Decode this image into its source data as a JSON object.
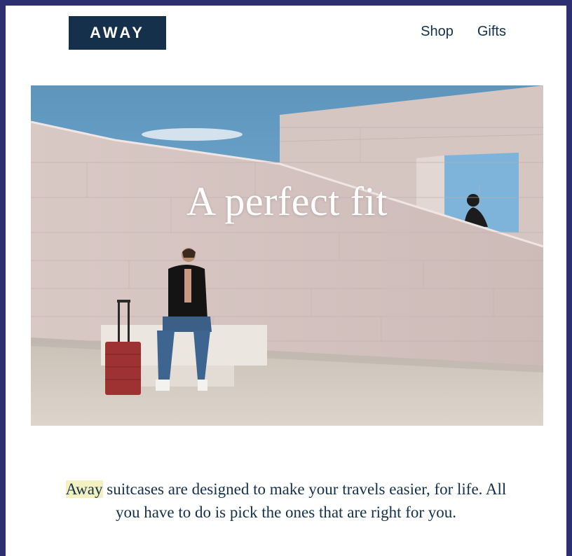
{
  "header": {
    "logo_text": "AWAY",
    "nav": [
      {
        "label": "Shop"
      },
      {
        "label": "Gifts"
      }
    ]
  },
  "hero": {
    "title": "A perfect fit"
  },
  "body": {
    "highlight": "Away",
    "text": " suitcases are designed to make your travels easier, for life. All you have to do is pick the ones that are right for you."
  },
  "colors": {
    "brand_navy": "#14304a",
    "frame_border": "#2e2f72",
    "highlight": "#f3f1c0",
    "suitcase_red": "#9e3233"
  }
}
